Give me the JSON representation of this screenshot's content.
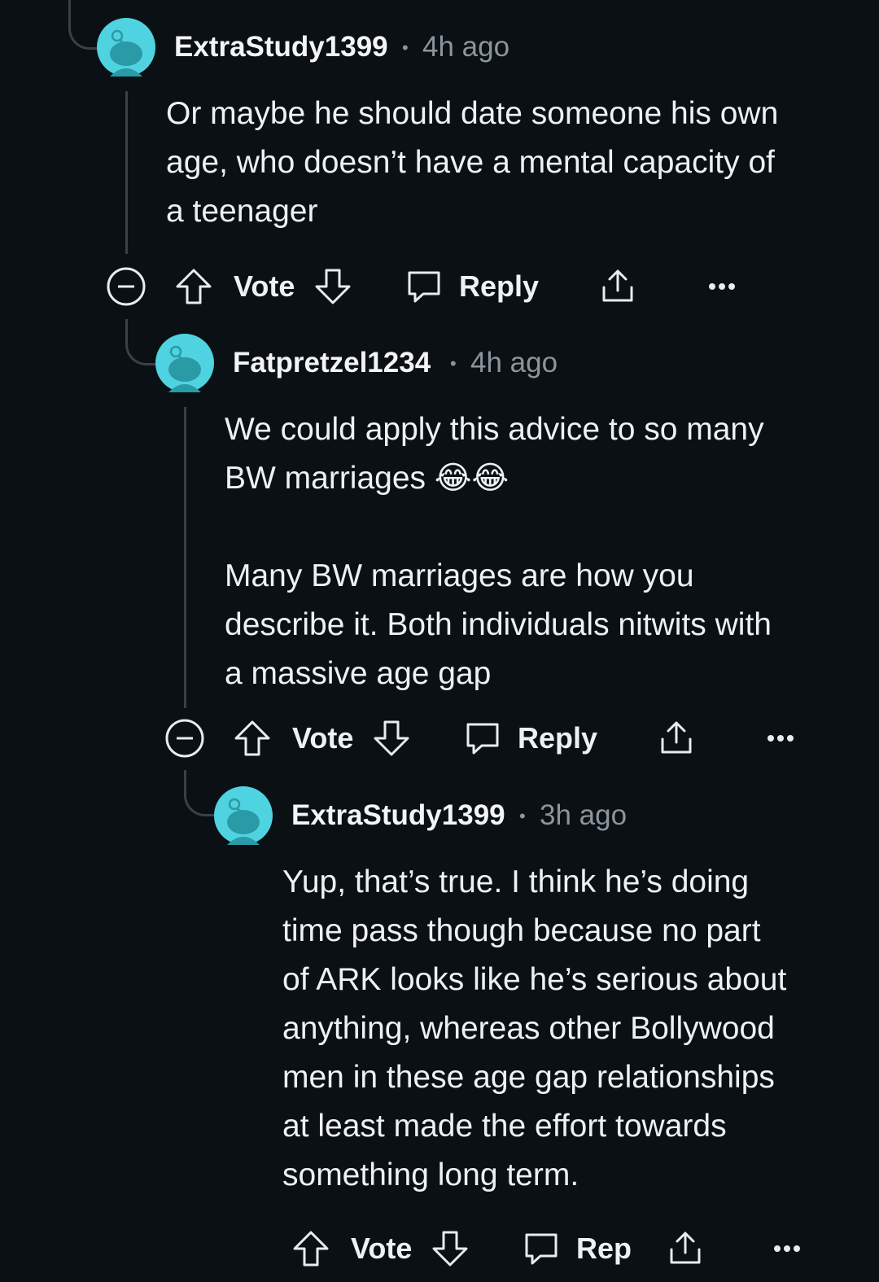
{
  "colors": {
    "background": "#0b1014",
    "avatar": "#4fd3e0",
    "thread_line": "#3a4045",
    "muted": "#8b959c"
  },
  "comments": [
    {
      "username": "ExtraStudy1399",
      "separator": "•",
      "time": "4h ago",
      "body": "Or maybe he should date someone his own\nage, who doesn’t have a mental capacity of\na teenager",
      "actions": {
        "vote": "Vote",
        "reply": "Reply"
      }
    },
    {
      "username": "Fatpretzel1234",
      "separator": "•",
      "time": "4h ago",
      "body": "We could apply this advice to so many\nBW marriages 😂😂\n\nMany BW marriages are how you\ndescribe it. Both individuals nitwits with\na massive age gap",
      "actions": {
        "vote": "Vote",
        "reply": "Reply"
      }
    },
    {
      "username": "ExtraStudy1399",
      "separator": "•",
      "time": "3h ago",
      "body": "Yup, that’s true. I think he’s doing\ntime pass though because no part\nof ARK looks like he’s serious about\nanything, whereas other Bollywood\nmen in these age gap relationships\nat least made the effort towards\nsomething long term.",
      "actions": {
        "vote": "Vote",
        "reply": "Rep"
      }
    }
  ],
  "icons": [
    "collapse-icon",
    "upvote-icon",
    "downvote-icon",
    "reply-icon",
    "share-icon",
    "more-icon",
    "avatar-icon"
  ]
}
